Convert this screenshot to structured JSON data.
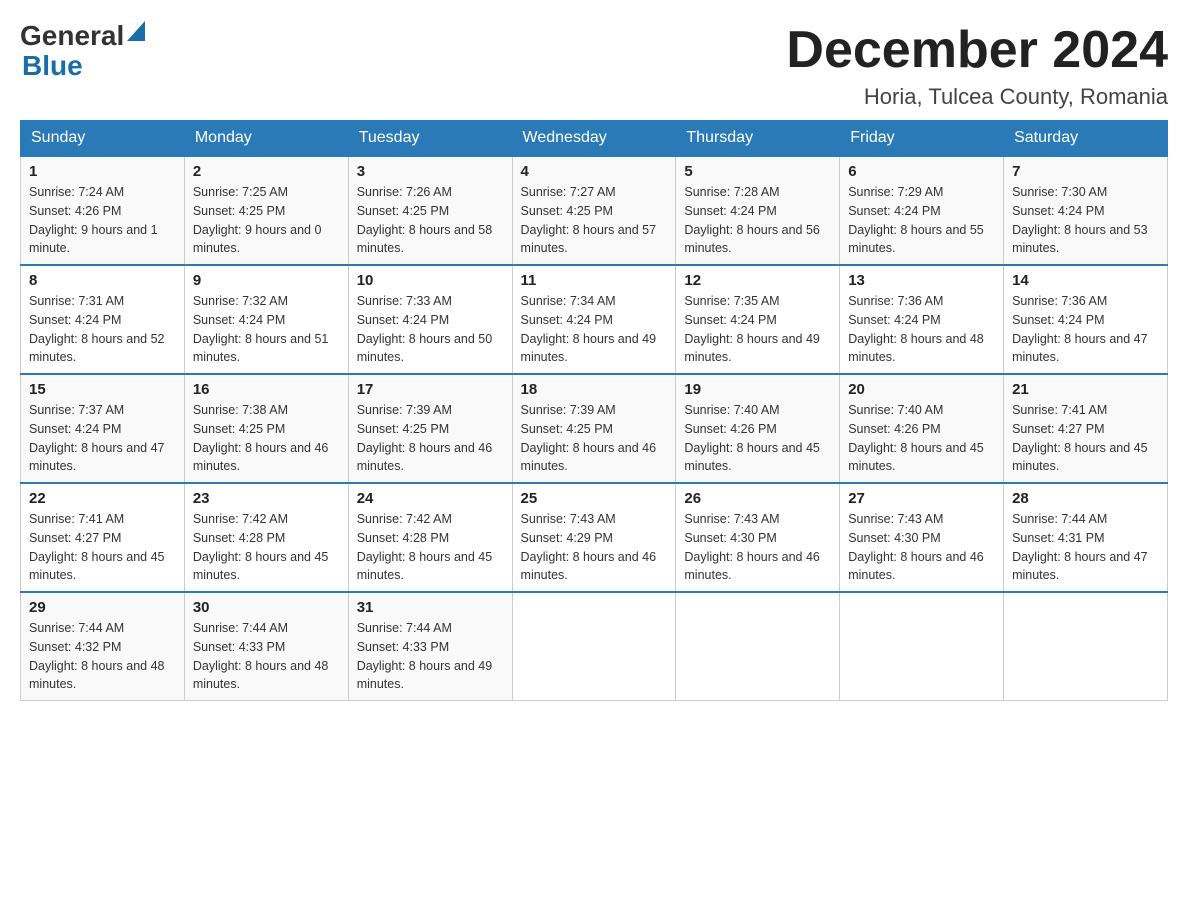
{
  "logo": {
    "general": "General",
    "blue": "Blue"
  },
  "title": "December 2024",
  "subtitle": "Horia, Tulcea County, Romania",
  "weekdays": [
    "Sunday",
    "Monday",
    "Tuesday",
    "Wednesday",
    "Thursday",
    "Friday",
    "Saturday"
  ],
  "weeks": [
    [
      {
        "day": "1",
        "sunrise": "7:24 AM",
        "sunset": "4:26 PM",
        "daylight": "9 hours and 1 minute."
      },
      {
        "day": "2",
        "sunrise": "7:25 AM",
        "sunset": "4:25 PM",
        "daylight": "9 hours and 0 minutes."
      },
      {
        "day": "3",
        "sunrise": "7:26 AM",
        "sunset": "4:25 PM",
        "daylight": "8 hours and 58 minutes."
      },
      {
        "day": "4",
        "sunrise": "7:27 AM",
        "sunset": "4:25 PM",
        "daylight": "8 hours and 57 minutes."
      },
      {
        "day": "5",
        "sunrise": "7:28 AM",
        "sunset": "4:24 PM",
        "daylight": "8 hours and 56 minutes."
      },
      {
        "day": "6",
        "sunrise": "7:29 AM",
        "sunset": "4:24 PM",
        "daylight": "8 hours and 55 minutes."
      },
      {
        "day": "7",
        "sunrise": "7:30 AM",
        "sunset": "4:24 PM",
        "daylight": "8 hours and 53 minutes."
      }
    ],
    [
      {
        "day": "8",
        "sunrise": "7:31 AM",
        "sunset": "4:24 PM",
        "daylight": "8 hours and 52 minutes."
      },
      {
        "day": "9",
        "sunrise": "7:32 AM",
        "sunset": "4:24 PM",
        "daylight": "8 hours and 51 minutes."
      },
      {
        "day": "10",
        "sunrise": "7:33 AM",
        "sunset": "4:24 PM",
        "daylight": "8 hours and 50 minutes."
      },
      {
        "day": "11",
        "sunrise": "7:34 AM",
        "sunset": "4:24 PM",
        "daylight": "8 hours and 49 minutes."
      },
      {
        "day": "12",
        "sunrise": "7:35 AM",
        "sunset": "4:24 PM",
        "daylight": "8 hours and 49 minutes."
      },
      {
        "day": "13",
        "sunrise": "7:36 AM",
        "sunset": "4:24 PM",
        "daylight": "8 hours and 48 minutes."
      },
      {
        "day": "14",
        "sunrise": "7:36 AM",
        "sunset": "4:24 PM",
        "daylight": "8 hours and 47 minutes."
      }
    ],
    [
      {
        "day": "15",
        "sunrise": "7:37 AM",
        "sunset": "4:24 PM",
        "daylight": "8 hours and 47 minutes."
      },
      {
        "day": "16",
        "sunrise": "7:38 AM",
        "sunset": "4:25 PM",
        "daylight": "8 hours and 46 minutes."
      },
      {
        "day": "17",
        "sunrise": "7:39 AM",
        "sunset": "4:25 PM",
        "daylight": "8 hours and 46 minutes."
      },
      {
        "day": "18",
        "sunrise": "7:39 AM",
        "sunset": "4:25 PM",
        "daylight": "8 hours and 46 minutes."
      },
      {
        "day": "19",
        "sunrise": "7:40 AM",
        "sunset": "4:26 PM",
        "daylight": "8 hours and 45 minutes."
      },
      {
        "day": "20",
        "sunrise": "7:40 AM",
        "sunset": "4:26 PM",
        "daylight": "8 hours and 45 minutes."
      },
      {
        "day": "21",
        "sunrise": "7:41 AM",
        "sunset": "4:27 PM",
        "daylight": "8 hours and 45 minutes."
      }
    ],
    [
      {
        "day": "22",
        "sunrise": "7:41 AM",
        "sunset": "4:27 PM",
        "daylight": "8 hours and 45 minutes."
      },
      {
        "day": "23",
        "sunrise": "7:42 AM",
        "sunset": "4:28 PM",
        "daylight": "8 hours and 45 minutes."
      },
      {
        "day": "24",
        "sunrise": "7:42 AM",
        "sunset": "4:28 PM",
        "daylight": "8 hours and 45 minutes."
      },
      {
        "day": "25",
        "sunrise": "7:43 AM",
        "sunset": "4:29 PM",
        "daylight": "8 hours and 46 minutes."
      },
      {
        "day": "26",
        "sunrise": "7:43 AM",
        "sunset": "4:30 PM",
        "daylight": "8 hours and 46 minutes."
      },
      {
        "day": "27",
        "sunrise": "7:43 AM",
        "sunset": "4:30 PM",
        "daylight": "8 hours and 46 minutes."
      },
      {
        "day": "28",
        "sunrise": "7:44 AM",
        "sunset": "4:31 PM",
        "daylight": "8 hours and 47 minutes."
      }
    ],
    [
      {
        "day": "29",
        "sunrise": "7:44 AM",
        "sunset": "4:32 PM",
        "daylight": "8 hours and 48 minutes."
      },
      {
        "day": "30",
        "sunrise": "7:44 AM",
        "sunset": "4:33 PM",
        "daylight": "8 hours and 48 minutes."
      },
      {
        "day": "31",
        "sunrise": "7:44 AM",
        "sunset": "4:33 PM",
        "daylight": "8 hours and 49 minutes."
      },
      null,
      null,
      null,
      null
    ]
  ],
  "labels": {
    "sunrise": "Sunrise:",
    "sunset": "Sunset:",
    "daylight": "Daylight:"
  }
}
